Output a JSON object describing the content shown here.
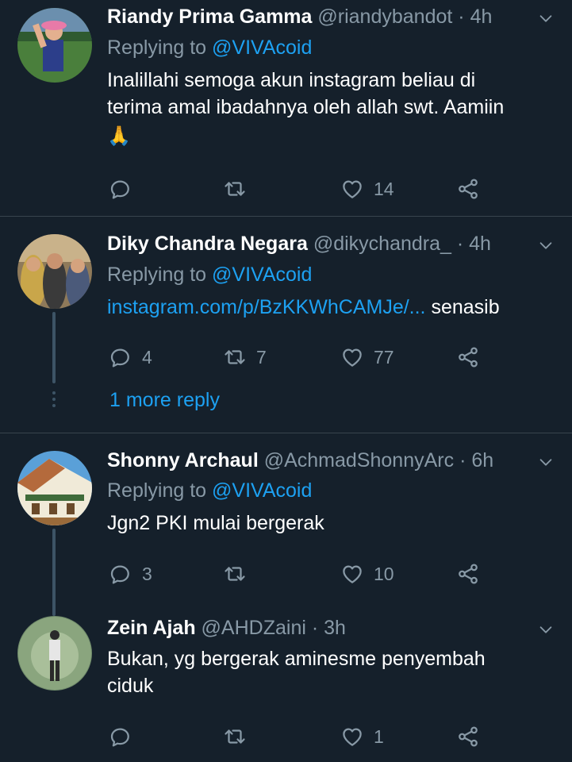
{
  "colors": {
    "background": "#15202b",
    "divider": "#38444d",
    "text_primary": "#ffffff",
    "text_secondary": "#8899a6",
    "link": "#1da1f2"
  },
  "tweets": [
    {
      "name": "Riandy Prima Gamma",
      "handle": "@riandybandot",
      "separator": "·",
      "time": "4h",
      "replying_prefix": "Replying to",
      "replying_to": "@VIVAcoid",
      "text_lines": [
        "Inalillahi semoga akun instagram beliau di",
        "terima amal ibadahnya oleh allah swt. Aamiin"
      ],
      "emoji": "🙏",
      "reply_count": "",
      "retweet_count": "",
      "like_count": "14"
    },
    {
      "name": "Diky Chandra Negara",
      "handle": "@dikychandra_",
      "separator": "·",
      "time": "4h",
      "replying_prefix": "Replying to",
      "replying_to": "@VIVAcoid",
      "link_text": "instagram.com/p/BzKKWhCAMJe/...",
      "after_link_text": "senasib",
      "reply_count": "4",
      "retweet_count": "7",
      "like_count": "77",
      "more_replies": "1 more reply"
    },
    {
      "name": "Shonny Archaul",
      "handle": "@AchmadShonnyArc",
      "separator": "·",
      "time": "6h",
      "replying_prefix": "Replying to",
      "replying_to": "@VIVAcoid",
      "text_lines": [
        "Jgn2 PKI mulai bergerak"
      ],
      "reply_count": "3",
      "retweet_count": "",
      "like_count": "10"
    },
    {
      "name": "Zein Ajah",
      "handle": "@AHDZaini",
      "separator": "·",
      "time": "3h",
      "text_lines": [
        "Bukan, yg bergerak aminesme penyembah",
        "ciduk"
      ],
      "reply_count": "",
      "retweet_count": "",
      "like_count": "1"
    }
  ],
  "icons": [
    "reply-icon",
    "retweet-icon",
    "like-icon",
    "share-icon",
    "chevron-down-icon"
  ]
}
